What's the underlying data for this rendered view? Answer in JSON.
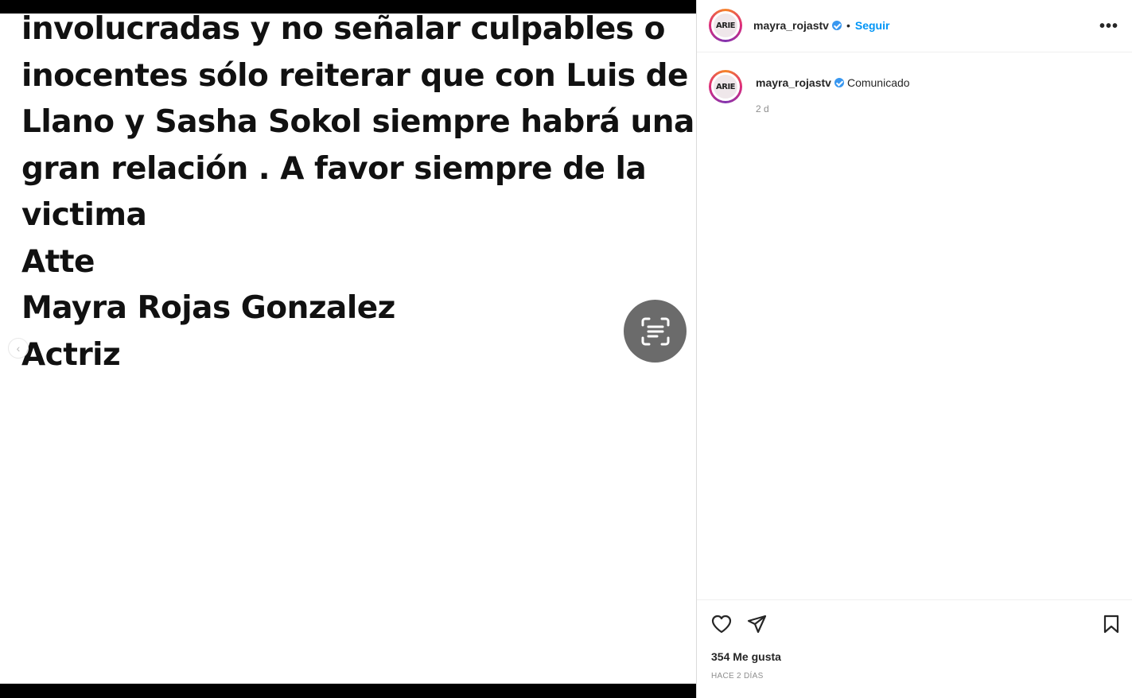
{
  "post": {
    "text_lines": [
      "involucradas y no señalar culpables o",
      "inocentes sólo reiterar que con  Luis de",
      "Llano y Sasha Sokol siempre habrá una",
      "gran relación . A favor siempre de la",
      "victima",
      "Atte",
      "Mayra Rojas Gonzalez",
      "Actriz"
    ]
  },
  "header": {
    "username": "mayra_rojastv",
    "separator": "•",
    "follow_label": "Seguir",
    "more_label": "•••",
    "avatar_text": "ARIE"
  },
  "caption": {
    "username": "mayra_rojastv",
    "text": "Comunicado",
    "time": "2 d"
  },
  "footer": {
    "likes": "354 Me gusta",
    "timestamp": "HACE 2 DÍAS"
  },
  "colors": {
    "accent": "#0095f6",
    "verified": "#3897f0",
    "muted": "#8e8e8e"
  },
  "icons": [
    "chevron-left-icon",
    "text-lens-icon",
    "more-icon",
    "heart-icon",
    "share-icon",
    "bookmark-icon",
    "verified-icon"
  ]
}
